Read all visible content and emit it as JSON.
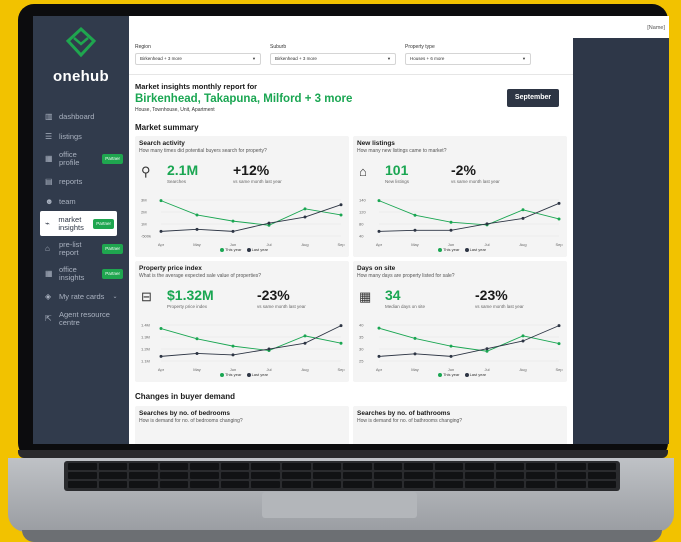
{
  "user_name": "[Name]",
  "brand": "onehub",
  "sidebar": {
    "items": [
      {
        "label": "dashboard",
        "icon": "dashboard-icon"
      },
      {
        "label": "listings",
        "icon": "list-icon"
      },
      {
        "label": "office profile",
        "icon": "building-icon",
        "badge": "Partner"
      },
      {
        "label": "reports",
        "icon": "reports-icon"
      },
      {
        "label": "team",
        "icon": "team-icon"
      },
      {
        "label": "market insights",
        "icon": "chart-icon",
        "badge": "Partner",
        "active": true
      },
      {
        "label": "pre-list report",
        "icon": "home-icon",
        "badge": "Partner"
      },
      {
        "label": "office insights",
        "icon": "office-icon",
        "badge": "Partner"
      },
      {
        "label": "My rate cards",
        "icon": "tag-icon"
      },
      {
        "label": "Agent resource centre",
        "icon": "external-link-icon"
      }
    ]
  },
  "filters": {
    "region": {
      "label": "Region",
      "value": "Birkenhead + 3 more"
    },
    "suburb": {
      "label": "Suburb",
      "value": "Birkenhead + 3 more"
    },
    "property_type": {
      "label": "Property type",
      "value": "Houses + 6 more"
    }
  },
  "report": {
    "subtitle": "Market insights monthly report for",
    "title": "Birkenhead, Takapuna, Milford + 3 more",
    "types": "House, Townhouse, Unit, Apartment",
    "month_button": "September"
  },
  "sections": {
    "market_summary": "Market summary",
    "buyer_demand": "Changes in buyer demand"
  },
  "cards": {
    "search": {
      "title": "Search activity",
      "question": "How many times did potential buyers search for property?",
      "value": "2.1M",
      "value_label": "Searches",
      "change": "+12%",
      "change_label": "vs same month last year"
    },
    "listings": {
      "title": "New listings",
      "question": "How many new listings came to market?",
      "value": "101",
      "value_label": "New listings",
      "change": "-2%",
      "change_label": "vs same month last year"
    },
    "price": {
      "title": "Property price index",
      "question": "What is the average expected sale value of properties?",
      "value": "$1.32M",
      "value_label": "Property price index",
      "change": "-23%",
      "change_label": "vs same month last year"
    },
    "days": {
      "title": "Days on site",
      "question": "How many days are property listed for sale?",
      "value": "34",
      "value_label": "Median days on site",
      "change": "-23%",
      "change_label": "vs same month last year"
    },
    "bedrooms": {
      "title": "Searches by no. of bedrooms",
      "question": "How is demand for no. of bedrooms changing?"
    },
    "bathrooms": {
      "title": "Searches by no. of bathrooms",
      "question": "How is demand for no. of bathrooms changing?"
    }
  },
  "legend": {
    "this_year": "This year",
    "last_year": "Last year"
  },
  "colors": {
    "green": "#1aa652",
    "dark": "#2d3544",
    "sidebar": "#313b4c",
    "background": "#f2c200"
  },
  "chart_data": [
    {
      "type": "line",
      "title": "Search activity",
      "categories": [
        "Apr",
        "May",
        "Jun",
        "Jul",
        "Aug",
        "Sep"
      ],
      "y_ticks": [
        "3M",
        "2M",
        "1M",
        "-500k"
      ],
      "series": [
        {
          "name": "This year",
          "values": [
            2.8,
            2.1,
            1.8,
            1.6,
            2.4,
            2.1
          ]
        },
        {
          "name": "Last year",
          "values": [
            1.3,
            1.4,
            1.3,
            1.7,
            2.0,
            2.6
          ]
        }
      ]
    },
    {
      "type": "line",
      "title": "New listings",
      "categories": [
        "Apr",
        "May",
        "Jun",
        "Jul",
        "Aug",
        "Sep"
      ],
      "y_ticks": [
        "140",
        "120",
        "80",
        "40"
      ],
      "series": [
        {
          "name": "This year",
          "values": [
            135,
            108,
            95,
            90,
            118,
            101
          ]
        },
        {
          "name": "Last year",
          "values": [
            78,
            80,
            80,
            92,
            102,
            130
          ]
        }
      ]
    },
    {
      "type": "line",
      "title": "Property price index",
      "categories": [
        "Apr",
        "May",
        "Jun",
        "Jul",
        "Aug",
        "Sep"
      ],
      "y_ticks": [
        "1.4M",
        "1.3M",
        "1.2M",
        "1.1M"
      ],
      "series": [
        {
          "name": "This year",
          "values": [
            1.42,
            1.35,
            1.3,
            1.27,
            1.37,
            1.32
          ]
        },
        {
          "name": "Last year",
          "values": [
            1.23,
            1.25,
            1.24,
            1.28,
            1.32,
            1.44
          ]
        }
      ]
    },
    {
      "type": "line",
      "title": "Days on site",
      "categories": [
        "Apr",
        "May",
        "Jun",
        "Jul",
        "Aug",
        "Sep"
      ],
      "y_ticks": [
        "40",
        "35",
        "30",
        "25"
      ],
      "series": [
        {
          "name": "This year",
          "values": [
            40,
            36,
            33,
            31,
            37,
            34
          ]
        },
        {
          "name": "Last year",
          "values": [
            29,
            30,
            29,
            32,
            35,
            41
          ]
        }
      ]
    }
  ]
}
